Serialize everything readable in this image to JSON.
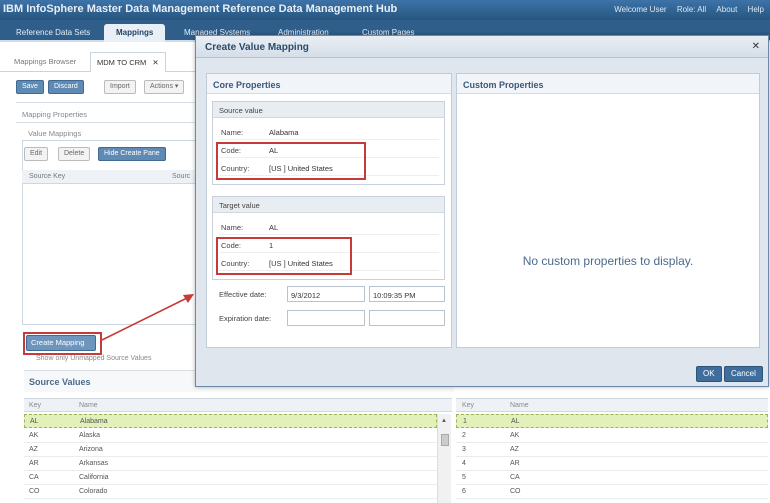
{
  "app": {
    "title": "IBM InfoSphere Master Data Management Reference Data Management Hub",
    "links": [
      "Welcome User",
      "Role: All",
      "About",
      "Help"
    ]
  },
  "main_tabs": [
    "Reference Data Sets",
    "Mappings",
    "Managed Systems",
    "Administration",
    "Custom Pages"
  ],
  "sub_tabs": [
    "Mappings Browser",
    "MDM TO CRM"
  ],
  "toolbar": {
    "save": "Save",
    "discard": "Discard",
    "import": "Import",
    "actions": "Actions"
  },
  "left": {
    "mapping_properties": "Mapping Properties",
    "value_mappings": "Value Mappings",
    "edit": "Edit",
    "delete": "Delete",
    "hide_create_pane": "Hide Create Pane",
    "col_source_key": "Source Key",
    "col_source": "Sourc",
    "create_mapping": "Create Mapping",
    "show_unmapped": "Show only Unmapped Source Values",
    "source_values_title": "Source Values"
  },
  "source_grid": {
    "headers": [
      "Key",
      "Name"
    ],
    "rows": [
      [
        "AL",
        "Alabama"
      ],
      [
        "AK",
        "Alaska"
      ],
      [
        "AZ",
        "Arizona"
      ],
      [
        "AR",
        "Arkansas"
      ],
      [
        "CA",
        "California"
      ],
      [
        "CO",
        "Colorado"
      ]
    ]
  },
  "target_grid": {
    "headers": [
      "Key",
      "Name"
    ],
    "rows": [
      [
        "1",
        "AL"
      ],
      [
        "2",
        "AK"
      ],
      [
        "3",
        "AZ"
      ],
      [
        "4",
        "AR"
      ],
      [
        "5",
        "CA"
      ],
      [
        "6",
        "CO"
      ]
    ]
  },
  "modal": {
    "title": "Create Value Mapping",
    "core_properties": "Core Properties",
    "custom_properties": "Custom Properties",
    "no_custom": "No custom properties to display.",
    "source_value": {
      "header": "Source value",
      "name_label": "Name:",
      "name": "Alabama",
      "code_label": "Code:",
      "code": "AL",
      "country_label": "Country:",
      "country": "[US ] United States"
    },
    "target_value": {
      "header": "Target value",
      "name_label": "Name:",
      "name": "AL",
      "code_label": "Code:",
      "code": "1",
      "country_label": "Country:",
      "country": "[US ] United States"
    },
    "effective_label": "Effective date:",
    "effective_date": "9/3/2012",
    "effective_time": "10:09:35 PM",
    "expiration_label": "Expiration date:",
    "ok": "OK",
    "cancel": "Cancel"
  },
  "colors": {
    "accent": "#3f6e9c",
    "highlight": "#c63a3a",
    "selected_row": "#e2f0b9"
  }
}
